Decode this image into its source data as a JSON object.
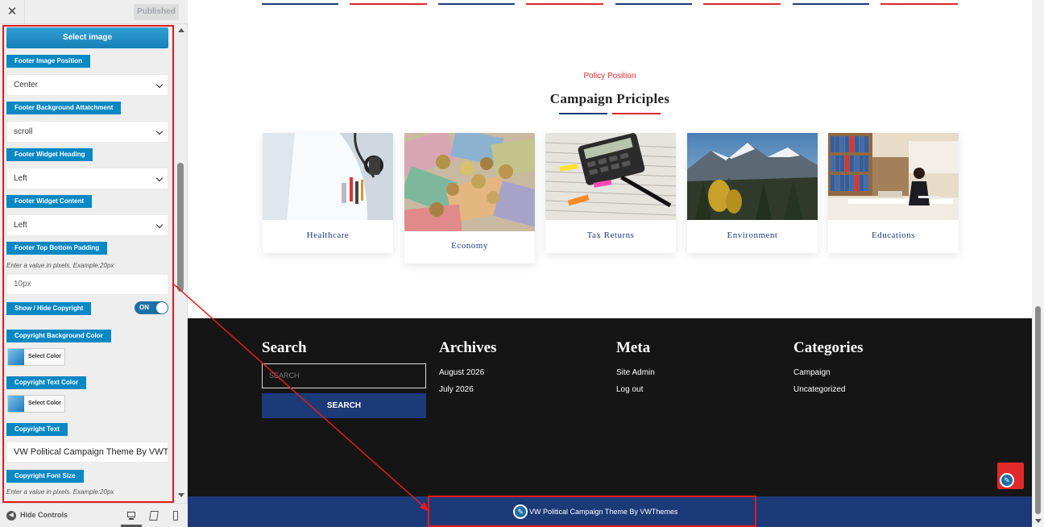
{
  "customizer": {
    "publish_label": "Published",
    "close_glyph": "✕",
    "select_image_label": "Select image",
    "footer_image_position": {
      "label": "Footer Image Position",
      "value": "Center"
    },
    "footer_bg_attachment": {
      "label": "Footer Background Attatchment",
      "value": "scroll"
    },
    "footer_widget_heading": {
      "label": "Footer Widget Heading",
      "value": "Left"
    },
    "footer_widget_content": {
      "label": "Footer Widget Content",
      "value": "Left"
    },
    "footer_padding": {
      "label": "Footer Top Bottom Padding",
      "description": "Enter a value in pixels. Example:20px",
      "placeholder": "10px"
    },
    "show_hide_copyright": {
      "label": "Show / Hide Copyright",
      "toggle_text": "ON"
    },
    "copyright_bg_color": {
      "label": "Copyright Background Color",
      "button": "Select Color"
    },
    "copyright_text_color": {
      "label": "Copyright Text Color",
      "button": "Select Color"
    },
    "copyright_text": {
      "label": "Copyright Text",
      "value": "VW Political Campaign Theme By VWThemes"
    },
    "copyright_font_size": {
      "label": "Copyright Font Size",
      "description": "Enter a value in pixels. Example:20px"
    },
    "hide_controls_label": "Hide Controls",
    "devices": [
      "desktop-icon",
      "tablet-icon",
      "mobile-icon"
    ],
    "accent_color": "#0a88c4"
  },
  "preview": {
    "kicker": "Policy Position",
    "title": "Campaign Priciples",
    "cards": [
      {
        "caption": "Healthcare",
        "image": "doctor-stethoscope"
      },
      {
        "caption": "Economy",
        "image": "euro-banknotes-coins"
      },
      {
        "caption": "Tax Returns",
        "image": "calculator-pen-papers"
      },
      {
        "caption": "Environment",
        "image": "mountain-forest"
      },
      {
        "caption": "Educations",
        "image": "office-woman-desk"
      }
    ],
    "footer": {
      "search": {
        "title": "Search",
        "placeholder": "SEARCH",
        "button": "SEARCH"
      },
      "archives": {
        "title": "Archives",
        "links": [
          "August 2026",
          "July 2026"
        ]
      },
      "meta": {
        "title": "Meta",
        "links": [
          "Site Admin",
          "Log out"
        ]
      },
      "categories": {
        "title": "Categories",
        "links": [
          "Campaign",
          "Uncategorized"
        ]
      }
    },
    "copyright": "VW Political Campaign Theme By VWThemes",
    "colors": {
      "navy": "#1c3a78",
      "red": "#e0272b",
      "footer_bg": "#151515"
    }
  }
}
